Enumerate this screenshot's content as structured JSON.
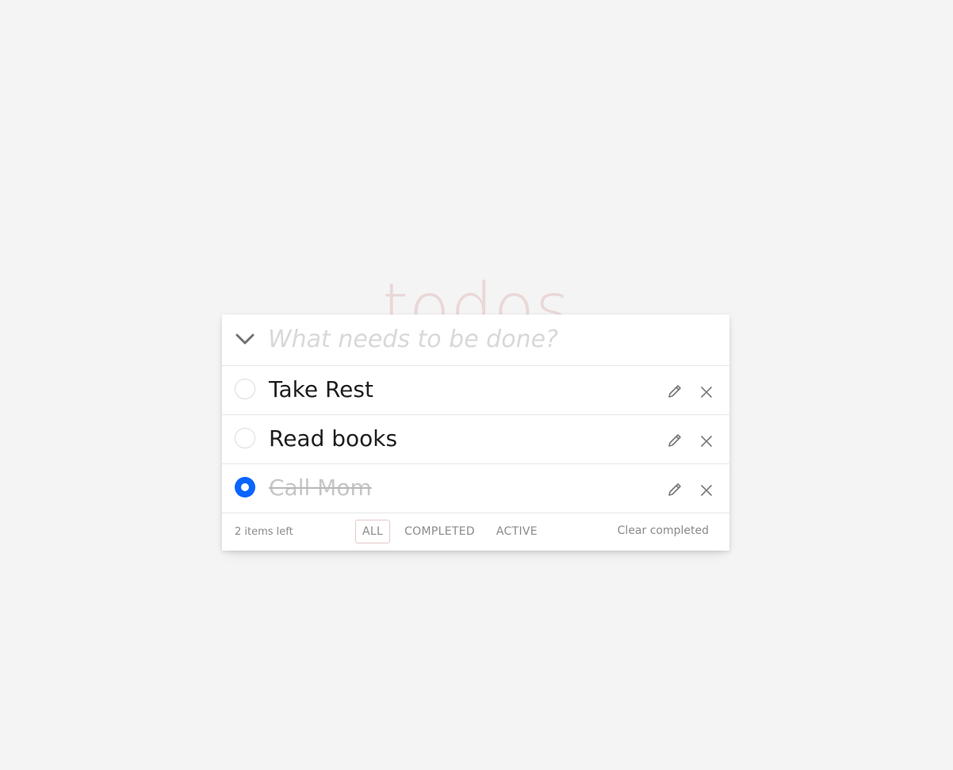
{
  "app": {
    "title": "todos"
  },
  "new_todo": {
    "placeholder": "What needs to be done?",
    "value": ""
  },
  "todos": [
    {
      "label": "Take Rest",
      "completed": false
    },
    {
      "label": "Read books",
      "completed": false
    },
    {
      "label": "Call Mom",
      "completed": true
    }
  ],
  "footer": {
    "items_left": "2 items left",
    "filters": [
      "ALL",
      "COMPLETED",
      "ACTIVE"
    ],
    "selected_filter": "ALL",
    "clear_completed": "Clear completed"
  },
  "icons": {
    "toggle_all": "chevron-down-icon",
    "edit": "pencil-icon",
    "delete": "close-icon"
  },
  "colors": {
    "background": "#f4f4f4",
    "title": "#ead7d7",
    "accent_checked": "#0a64ff",
    "selected_filter_border": "#e5c9c9"
  }
}
